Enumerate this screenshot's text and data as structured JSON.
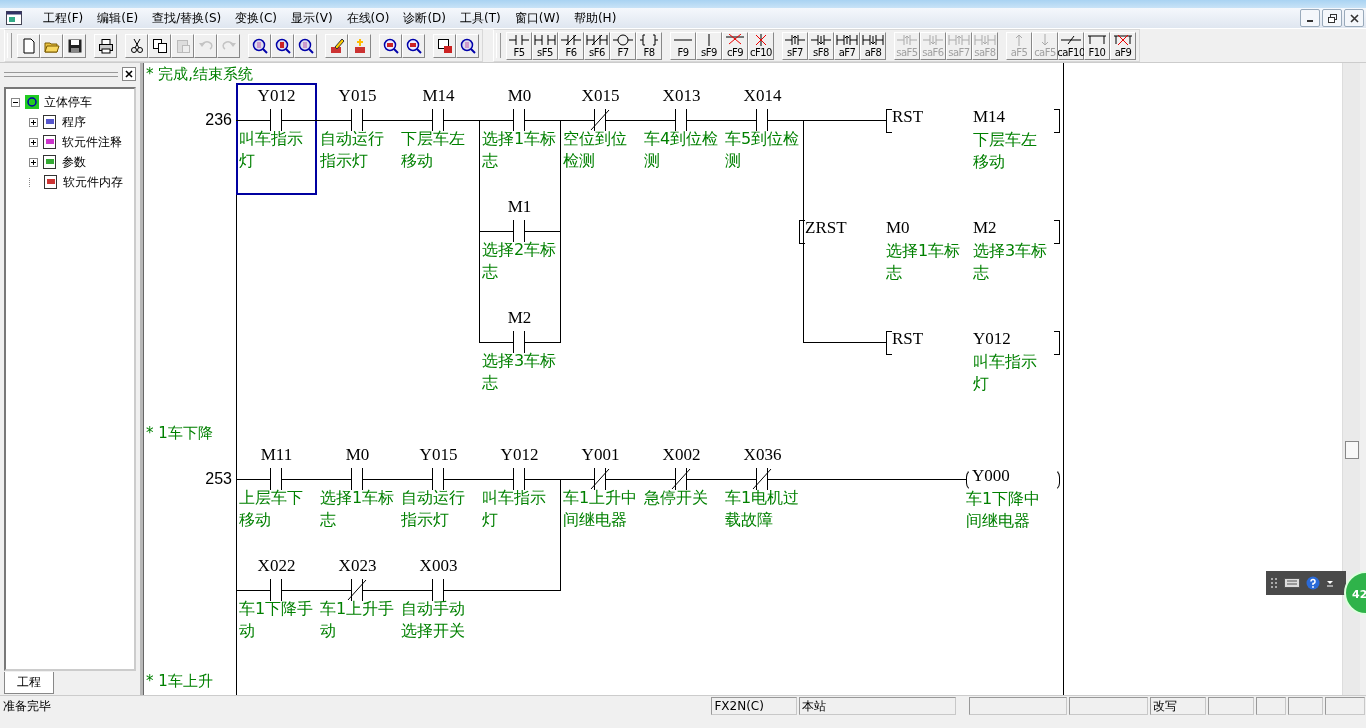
{
  "menu_bar": {
    "items": [
      "工程(F)",
      "编辑(E)",
      "查找/替换(S)",
      "变换(C)",
      "显示(V)",
      "在线(O)",
      "诊断(D)",
      "工具(T)",
      "窗口(W)",
      "帮助(H)"
    ]
  },
  "toolbar": {
    "groups": [
      [
        {
          "disabled": false
        },
        {
          "disabled": false
        },
        {
          "disabled": false
        }
      ],
      [
        {
          "disabled": false
        }
      ],
      [
        {
          "disabled": false
        },
        {
          "disabled": false
        },
        {
          "disabled": true
        },
        {
          "disabled": true
        },
        {
          "disabled": true
        }
      ],
      [
        {
          "disabled": false
        },
        {
          "disabled": false
        },
        {
          "disabled": false
        }
      ],
      [
        {
          "disabled": false
        },
        {
          "disabled": false
        }
      ],
      [
        {
          "disabled": false
        },
        {
          "disabled": false
        }
      ],
      [
        {
          "disabled": false
        },
        {
          "disabled": false
        }
      ]
    ]
  },
  "function_keys": {
    "groups": [
      [
        {
          "label": "F5",
          "disabled": false
        },
        {
          "label": "sF5",
          "disabled": false
        },
        {
          "label": "F6",
          "disabled": false
        },
        {
          "label": "sF6",
          "disabled": false
        },
        {
          "label": "F7",
          "disabled": false
        },
        {
          "label": "F8",
          "disabled": false
        }
      ],
      [
        {
          "label": "F9",
          "disabled": false
        },
        {
          "label": "sF9",
          "disabled": false
        },
        {
          "label": "cF9",
          "disabled": false
        },
        {
          "label": "cF10",
          "disabled": false
        }
      ],
      [
        {
          "label": "sF7",
          "disabled": false
        },
        {
          "label": "sF8",
          "disabled": false
        },
        {
          "label": "aF7",
          "disabled": false
        },
        {
          "label": "aF8",
          "disabled": false
        }
      ],
      [
        {
          "label": "saF5",
          "disabled": true
        },
        {
          "label": "saF6",
          "disabled": true
        },
        {
          "label": "saF7",
          "disabled": true
        },
        {
          "label": "saF8",
          "disabled": true
        }
      ],
      [
        {
          "label": "aF5",
          "disabled": true
        },
        {
          "label": "caF5",
          "disabled": true
        },
        {
          "label": "caF10",
          "disabled": false
        },
        {
          "label": "F10",
          "disabled": false
        },
        {
          "label": "aF9",
          "disabled": false
        }
      ]
    ]
  },
  "project_panel": {
    "tree": {
      "label": "立体停车",
      "expanded": true,
      "children": [
        {
          "label": "程序",
          "kind": "folder",
          "expanded": false
        },
        {
          "label": "软元件注释",
          "kind": "folder",
          "expanded": false
        },
        {
          "label": "参数",
          "kind": "folder",
          "expanded": false
        },
        {
          "label": "软元件内存",
          "kind": "leaf"
        }
      ]
    },
    "tab": "工程"
  },
  "ladder": {
    "rungs": [
      {
        "comment": "* 完成,结束系统",
        "step": "236",
        "rows": [
          [
            {
              "kind": "no",
              "device": "Y012",
              "comment": "叫车指示灯",
              "selected": true
            },
            {
              "kind": "no",
              "device": "Y015",
              "comment": "自动运行指示灯",
              "selected": false
            },
            {
              "kind": "no",
              "device": "M14",
              "comment": "下层车左移动",
              "selected": false
            },
            {
              "kind": "no",
              "device": "M0",
              "comment": "选择1车标志",
              "selected": false
            },
            {
              "kind": "nc",
              "device": "X015",
              "comment": "空位到位检测",
              "selected": false
            },
            {
              "kind": "no",
              "device": "X013",
              "comment": "车4到位检测",
              "selected": false
            },
            {
              "kind": "no",
              "device": "X014",
              "comment": "车5到位检测",
              "selected": false
            }
          ],
          [
            {
              "kind": "empty"
            },
            {
              "kind": "empty"
            },
            {
              "kind": "empty"
            },
            {
              "kind": "no",
              "device": "M1",
              "comment": "选择2车标志",
              "selected": false,
              "join_left": true,
              "join_right": true
            }
          ],
          [
            {
              "kind": "empty"
            },
            {
              "kind": "empty"
            },
            {
              "kind": "empty"
            },
            {
              "kind": "no",
              "device": "M2",
              "comment": "选择3车标志",
              "selected": false,
              "join_left": true,
              "join_right": true
            }
          ]
        ],
        "outputs": [
          {
            "kind": "instruction",
            "op": "RST",
            "operands": [
              {
                "device": "M14",
                "comment": "下层车左移动"
              }
            ]
          },
          {
            "kind": "instruction",
            "op": "ZRST",
            "operands": [
              {
                "device": "M0",
                "comment": "选择1车标志"
              },
              {
                "device": "M2",
                "comment": "选择3车标志"
              }
            ],
            "join_up": true
          },
          {
            "kind": "instruction",
            "op": "RST",
            "operands": [
              {
                "device": "Y012",
                "comment": "叫车指示灯"
              }
            ],
            "join_up": true
          }
        ]
      },
      {
        "comment": "* 1车下降",
        "step": "253",
        "rows": [
          [
            {
              "kind": "no",
              "device": "M11",
              "comment": "上层车下移动",
              "selected": false
            },
            {
              "kind": "no",
              "device": "M0",
              "comment": "选择1车标志",
              "selected": false
            },
            {
              "kind": "no",
              "device": "Y015",
              "comment": "自动运行指示灯",
              "selected": false
            },
            {
              "kind": "no",
              "device": "Y012",
              "comment": "叫车指示灯",
              "selected": false
            },
            {
              "kind": "nc",
              "device": "Y001",
              "comment": "车1上升中间继电器",
              "selected": false
            },
            {
              "kind": "nc",
              "device": "X002",
              "comment": "急停开关",
              "selected": false
            },
            {
              "kind": "nc",
              "device": "X036",
              "comment": "车1电机过载故障",
              "selected": false
            }
          ],
          [
            {
              "kind": "no",
              "device": "X022",
              "comment": "车1下降手动",
              "selected": false,
              "join_left": false,
              "join_right": false
            },
            {
              "kind": "nc",
              "device": "X023",
              "comment": "车1上升手动",
              "selected": false,
              "join_left": false,
              "join_right": false
            },
            {
              "kind": "no",
              "device": "X003",
              "comment": "自动手动选择开关",
              "selected": false,
              "join_left": false,
              "join_right": false
            },
            {
              "kind": "wire",
              "selected": false,
              "join_right": true
            }
          ]
        ],
        "outputs": [
          {
            "kind": "coil",
            "operands": [
              {
                "device": "Y000",
                "comment": "车1下降中间继电器"
              }
            ]
          }
        ]
      },
      {
        "comment": "* 1车上升"
      }
    ]
  },
  "overlay_badge": "42",
  "status_bar": {
    "message": "准备完毕",
    "plc": "FX2N(C)",
    "station": "本站",
    "mode": "改写"
  }
}
